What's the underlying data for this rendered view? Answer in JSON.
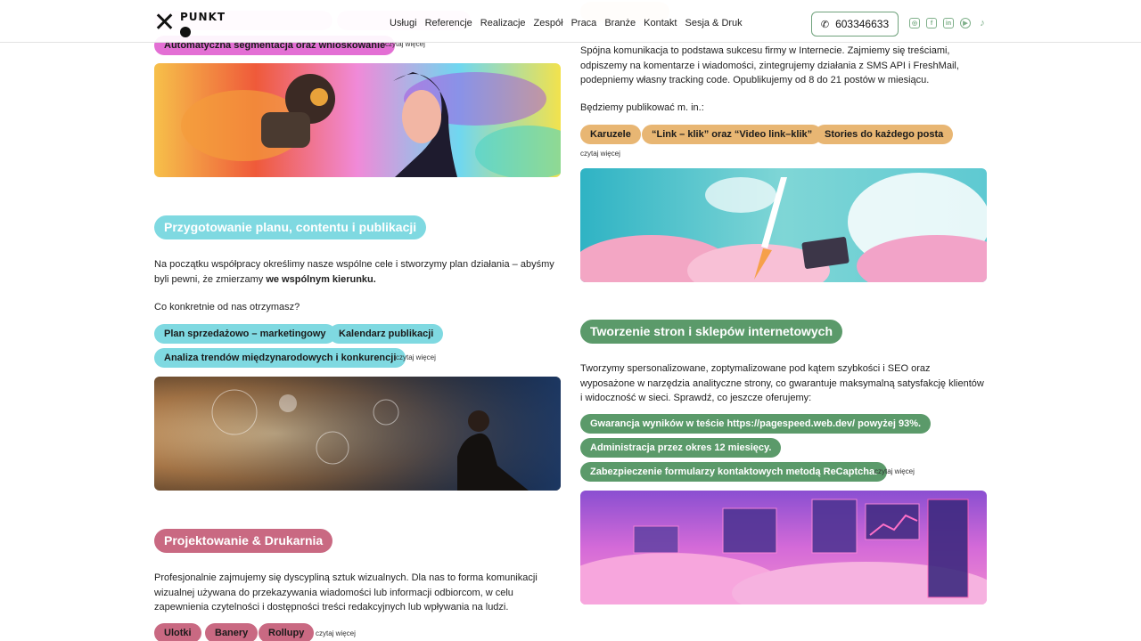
{
  "header": {
    "logo_text": "PUNKT",
    "nav": [
      "Usługi",
      "Referencje",
      "Realizacje",
      "Zespół",
      "Praca",
      "Branże",
      "Kontakt",
      "Sesja & Druk"
    ],
    "phone": "603346633",
    "socials": [
      "instagram-icon",
      "facebook-icon",
      "linkedin-icon",
      "youtube-icon",
      "tiktok-icon"
    ]
  },
  "left": {
    "ai": {
      "tags": [
        "Automatyczna segmentacja oraz wnioskowanie"
      ],
      "more": "czytaj więcej"
    },
    "plan": {
      "title": "Przygotowanie planu, contentu i publikacji",
      "p1": "Na początku współpracy określimy nasze wspólne cele i stworzymy plan działania – abyśmy byli pewni, że zmierzamy ",
      "p1_bold": "we wspólnym kierunku.",
      "p2": "Co konkretnie od nas otrzymasz?",
      "tags": [
        "Plan sprzedażowo – marketingowy",
        "Kalendarz publikacji",
        "Analiza trendów międzynarodowych i konkurencji"
      ],
      "more": "czytaj więcej"
    },
    "design": {
      "title": "Projektowanie & Drukarnia",
      "p1": "Profesjonalnie zajmujemy się dyscypliną sztuk wizualnych. Dla nas to forma komunikacji wizualnej używana do przekazywania wiadomości lub informacji odbiorcom, w celu zapewnienia czytelności i dostępności treści redakcyjnych lub wpływania na ludzi.",
      "tags": [
        "Ulotki",
        "Banery",
        "Rollupy"
      ],
      "more": "czytaj więcej"
    }
  },
  "right": {
    "social": {
      "p1": "Spójna komunikacja to podstawa sukcesu firmy w Internecie. Zajmiemy się treściami, odpiszemy na komentarze i wiadomości, zintegrujemy działania z SMS API i FreshMail, podepniemy własny tracking code. Opublikujemy od 8 do 21 postów w miesiącu.",
      "p2": "Będziemy publikować m. in.:",
      "tags": [
        "Karuzele",
        "“Link – klik” oraz “Video link–klik”",
        "Stories do każdego posta"
      ],
      "more": "czytaj więcej"
    },
    "web": {
      "title": "Tworzenie stron i sklepów internetowych",
      "p1": "Tworzymy spersonalizowane, zoptymalizowane pod kątem szybkości i SEO oraz wyposażone w narzędzia analityczne strony, co gwarantuje maksymalną satysfakcję klientów i widoczność w sieci. Sprawdź, co jeszcze oferujemy:",
      "tags": [
        "Gwarancja wyników w teście https://pagespeed.web.dev/ powyżej 93%.",
        "Administracja przez okres 12 miesięcy.",
        "Zabezpieczenie formularzy kontaktowych metodą ReCaptcha."
      ],
      "more": "czytaj więcej"
    }
  },
  "colors": {
    "magenta": "#e36fd4",
    "cyan": "#7fd9e1",
    "orange": "#e8b673",
    "green": "#5b9a6a",
    "rose": "#c96982"
  }
}
